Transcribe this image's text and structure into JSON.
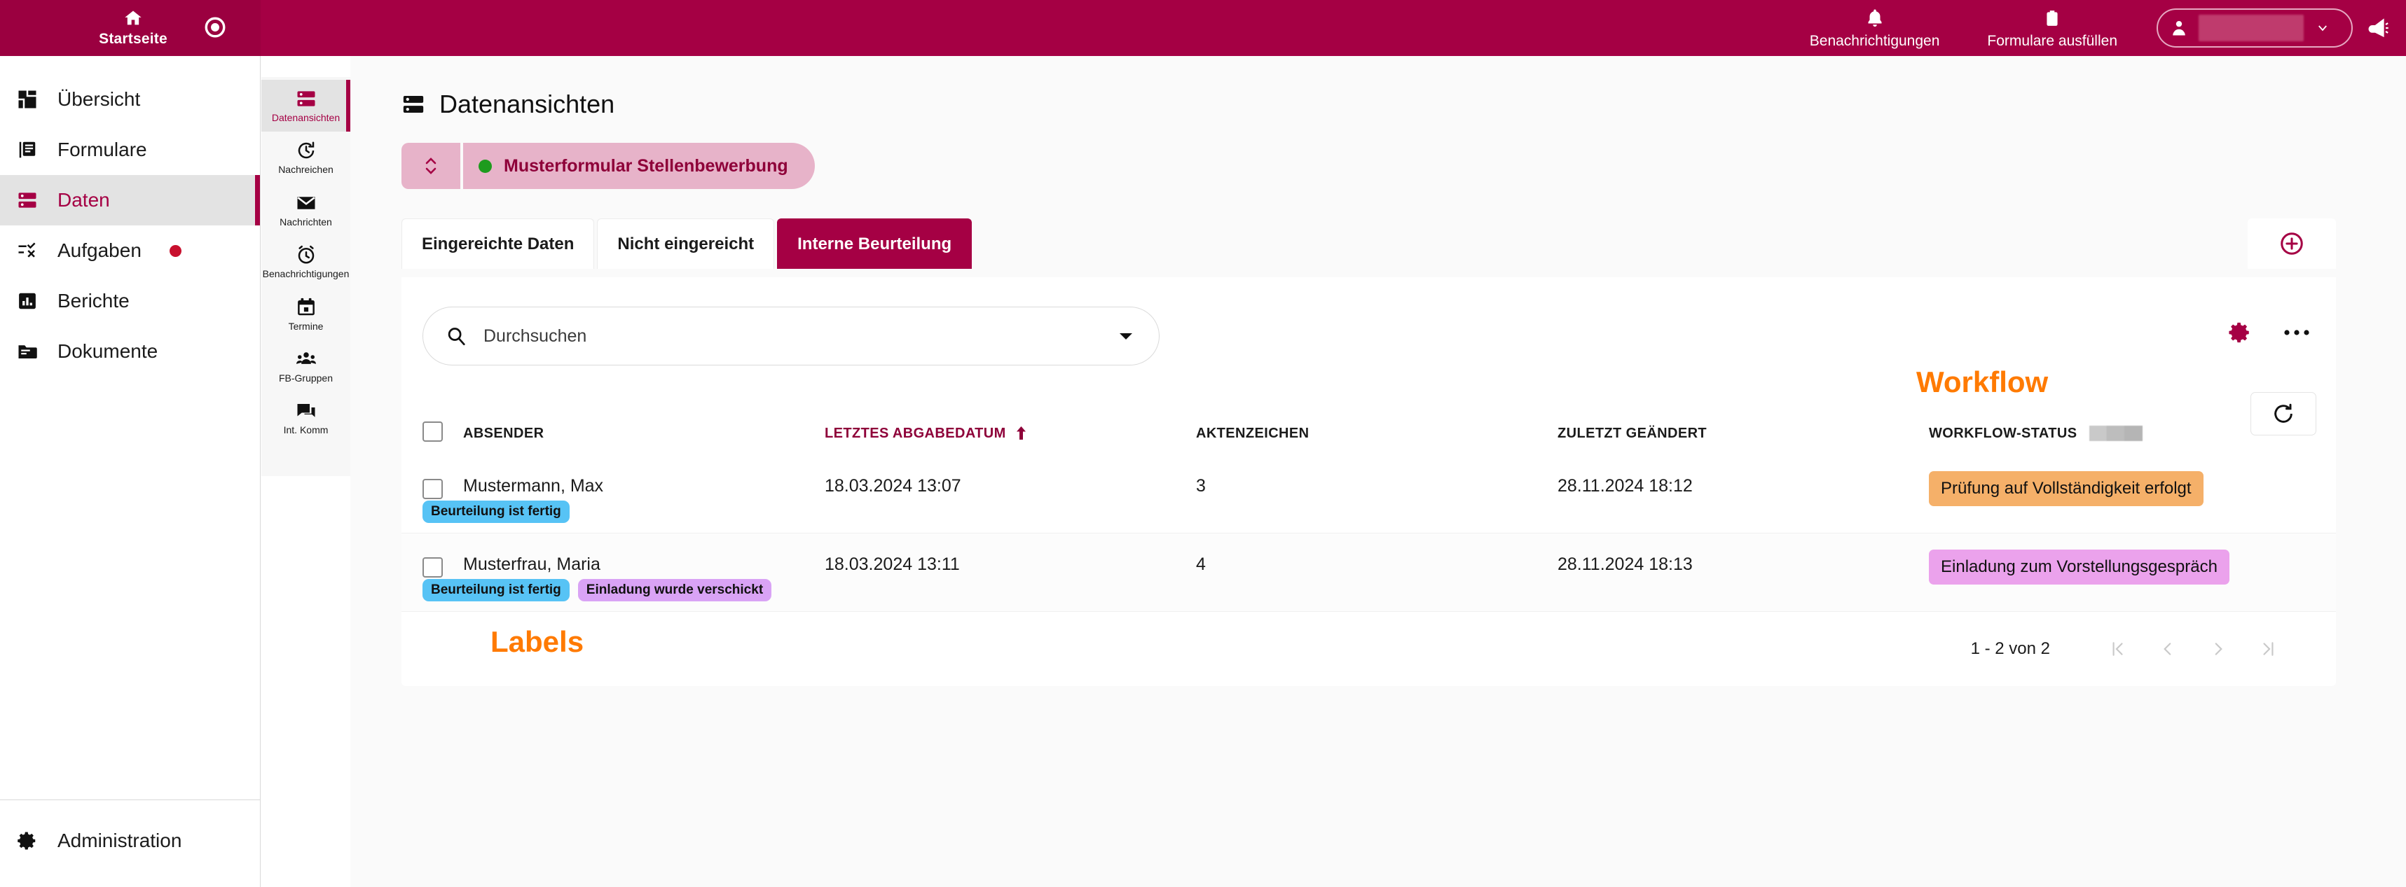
{
  "brand": {
    "primary": "#a50044",
    "accent_orange": "#ff7a00"
  },
  "topbar": {
    "home_label": "Startseite",
    "home_icon": "home-icon",
    "record_icon": "record-icon",
    "items": [
      {
        "label": "Benachrichtigungen",
        "icon": "bell-icon"
      },
      {
        "label": "Formulare ausfüllen",
        "icon": "clipboard-icon"
      }
    ],
    "user_menu": {
      "icon": "user-icon",
      "chevron": "chevron-down-icon",
      "name_redacted": ""
    },
    "megaphone_icon": "megaphone-icon"
  },
  "sidebar": {
    "items": [
      {
        "label": "Übersicht",
        "icon": "dashboard-icon",
        "active": false,
        "badge": false
      },
      {
        "label": "Formulare",
        "icon": "forms-icon",
        "active": false,
        "badge": false
      },
      {
        "label": "Daten",
        "icon": "database-icon",
        "active": true,
        "badge": false
      },
      {
        "label": "Aufgaben",
        "icon": "tasks-icon",
        "active": false,
        "badge": true
      },
      {
        "label": "Berichte",
        "icon": "reports-icon",
        "active": false,
        "badge": false
      },
      {
        "label": "Dokumente",
        "icon": "folder-icon",
        "active": false,
        "badge": false
      }
    ],
    "bottom": {
      "label": "Administration",
      "icon": "gear-icon"
    }
  },
  "rail": {
    "items": [
      {
        "label": "Datenansichten",
        "icon": "database-icon",
        "active": true
      },
      {
        "label": "Nachreichen",
        "icon": "history-icon",
        "active": false
      },
      {
        "label": "Nachrichten",
        "icon": "mail-icon",
        "active": false
      },
      {
        "label": "Benachrichtigungen",
        "icon": "alarm-clock-icon",
        "active": false
      },
      {
        "label": "Termine",
        "icon": "calendar-icon",
        "active": false
      },
      {
        "label": "FB-Gruppen",
        "icon": "group-icon",
        "active": false
      },
      {
        "label": "Int. Komm",
        "icon": "chat-icon",
        "active": false
      }
    ]
  },
  "main": {
    "page_title": "Datenansichten",
    "page_title_icon": "database-icon",
    "form_selector": {
      "stepper_icon": "stepper-updown-icon",
      "status_dot_color": "#1e9b1e",
      "label": "Musterformular Stellenbewerbung"
    },
    "tabs": [
      {
        "label": "Eingereichte Daten",
        "active": false
      },
      {
        "label": "Nicht eingereicht",
        "active": false
      },
      {
        "label": "Interne Beurteilung",
        "active": true
      }
    ],
    "add_button_icon": "plus-circle-icon",
    "search": {
      "placeholder": "Durchsuchen",
      "icon": "search-icon",
      "dropdown_icon": "caret-down-icon"
    },
    "panel_icons": [
      {
        "name": "settings-gear-icon",
        "icon": "gear-icon"
      },
      {
        "name": "more-options-icon",
        "icon": "ellipsis-icon"
      }
    ],
    "refresh_icon": "refresh-icon"
  },
  "table": {
    "columns": [
      {
        "key": "sender",
        "label": "ABSENDER",
        "sorted": false
      },
      {
        "key": "date",
        "label": "LETZTES ABGABEDATUM",
        "sorted": true,
        "sort_icon": "arrow-up-icon"
      },
      {
        "key": "akte",
        "label": "AKTENZEICHEN",
        "sorted": false
      },
      {
        "key": "mod",
        "label": "ZULETZT GEÄNDERT",
        "sorted": false
      },
      {
        "key": "wf",
        "label": "WORKFLOW-STATUS",
        "sorted": false,
        "redacted_suffix": true
      }
    ],
    "rows": [
      {
        "sender": "Mustermann, Max",
        "date": "18.03.2024 13:07",
        "akte": "3",
        "mod": "28.11.2024 18:12",
        "workflow": {
          "text": "Prüfung auf Vollständigkeit erfolgt",
          "bg": "#f5b069"
        },
        "labels": [
          {
            "text": "Beurteilung ist fertig",
            "bg": "#57c3f5"
          }
        ]
      },
      {
        "sender": "Musterfrau, Maria",
        "date": "18.03.2024 13:11",
        "akte": "4",
        "mod": "28.11.2024 18:13",
        "workflow": {
          "text": "Einladung zum Vorstellungsgespräch",
          "bg": "#eba2ec"
        },
        "labels": [
          {
            "text": "Beurteilung ist fertig",
            "bg": "#57c3f5"
          },
          {
            "text": "Einladung wurde verschickt",
            "bg": "#d9a3f5"
          }
        ]
      }
    ],
    "footer": {
      "page_info": "1 - 2 von 2",
      "buttons": [
        {
          "name": "first-page-button",
          "glyph": "|‹"
        },
        {
          "name": "previous-page-button",
          "glyph": "‹"
        },
        {
          "name": "next-page-button",
          "glyph": "›"
        },
        {
          "name": "last-page-button",
          "glyph": "›|"
        }
      ]
    }
  },
  "annotations": [
    {
      "text": "Workflow",
      "name": "annotation-workflow"
    },
    {
      "text": "Labels",
      "name": "annotation-labels"
    }
  ]
}
